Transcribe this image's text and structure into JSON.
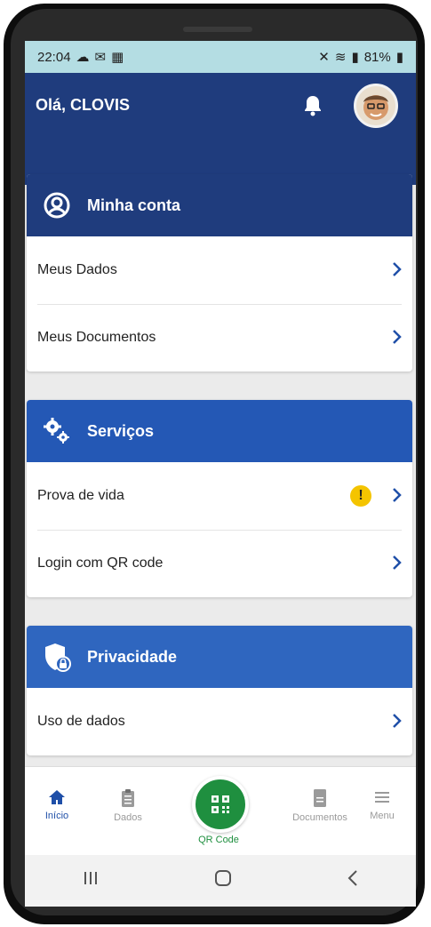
{
  "status_bar": {
    "time": "22:04",
    "battery": "81%"
  },
  "header": {
    "greeting": "Olá, CLOVIS"
  },
  "sections": [
    {
      "title": "Minha conta",
      "color": "#1f3c7d",
      "icon": "account-circle-icon",
      "items": [
        {
          "label": "Meus Dados"
        },
        {
          "label": "Meus Documentos"
        }
      ]
    },
    {
      "title": "Serviços",
      "color": "#2458b5",
      "icon": "gears-icon",
      "items": [
        {
          "label": "Prova de vida",
          "alert": "!"
        },
        {
          "label": "Login com QR code"
        }
      ]
    },
    {
      "title": "Privacidade",
      "color": "#2f66bf",
      "icon": "shield-lock-icon",
      "items": [
        {
          "label": "Uso de dados"
        }
      ]
    }
  ],
  "bottom_nav": {
    "items": [
      {
        "label": "Início",
        "icon": "home-icon",
        "active": true
      },
      {
        "label": "Dados",
        "icon": "clipboard-icon"
      },
      {
        "label": "QR Code",
        "icon": "qr-code-icon"
      },
      {
        "label": "Documentos",
        "icon": "document-icon"
      },
      {
        "label": "Menu",
        "icon": "hamburger-icon"
      }
    ]
  },
  "colors": {
    "header": "#1f3c7d",
    "qr_button": "#1f8f3f",
    "status_bar": "#b4dde3"
  }
}
